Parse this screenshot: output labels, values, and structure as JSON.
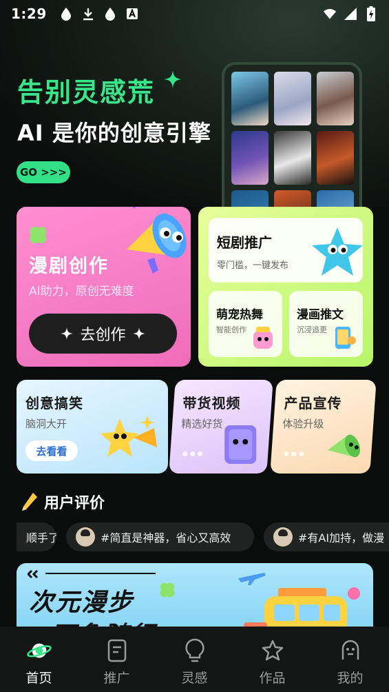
{
  "status_bar": {
    "time": "1:29"
  },
  "hero": {
    "title": "告别灵感荒",
    "subtitle": "AI 是你的创意引擎",
    "go_label": "GO >>>"
  },
  "feature_main": {
    "title": "漫剧创作",
    "subtitle": "AI助力，原创无难度",
    "button_label": "去创作"
  },
  "feature_side": {
    "top": {
      "title": "短剧推广",
      "subtitle": "零门槛，一键发布"
    },
    "left": {
      "title": "萌宠热舞",
      "subtitle": "智能创作"
    },
    "right": {
      "title": "漫画推文",
      "subtitle": "沉浸追更"
    }
  },
  "mini_cards": [
    {
      "title": "创意搞笑",
      "subtitle": "脑洞大开",
      "button": "去看看"
    },
    {
      "title": "带货视频",
      "subtitle": "精选好货"
    },
    {
      "title": "产品宣传",
      "subtitle": "体验升级"
    }
  ],
  "reviews": {
    "heading": "用户评价",
    "items": [
      "顺手了",
      "#简直是神器，省心又高效",
      "#有AI加持，做漫"
    ]
  },
  "banner": {
    "line1": "次元漫步",
    "line2": "万象随行"
  },
  "nav": [
    {
      "label": "首页",
      "icon": "planet-icon",
      "active": true
    },
    {
      "label": "推广",
      "icon": "document-icon",
      "active": false
    },
    {
      "label": "灵感",
      "icon": "lightbulb-icon",
      "active": false
    },
    {
      "label": "作品",
      "icon": "star-box-icon",
      "active": false
    },
    {
      "label": "我的",
      "icon": "profile-icon",
      "active": false
    }
  ],
  "colors": {
    "accent_green": "#39e68a",
    "background": "#0b0d0c",
    "pink_card": "#f47ac4",
    "lime_card": "#b7f56a"
  }
}
